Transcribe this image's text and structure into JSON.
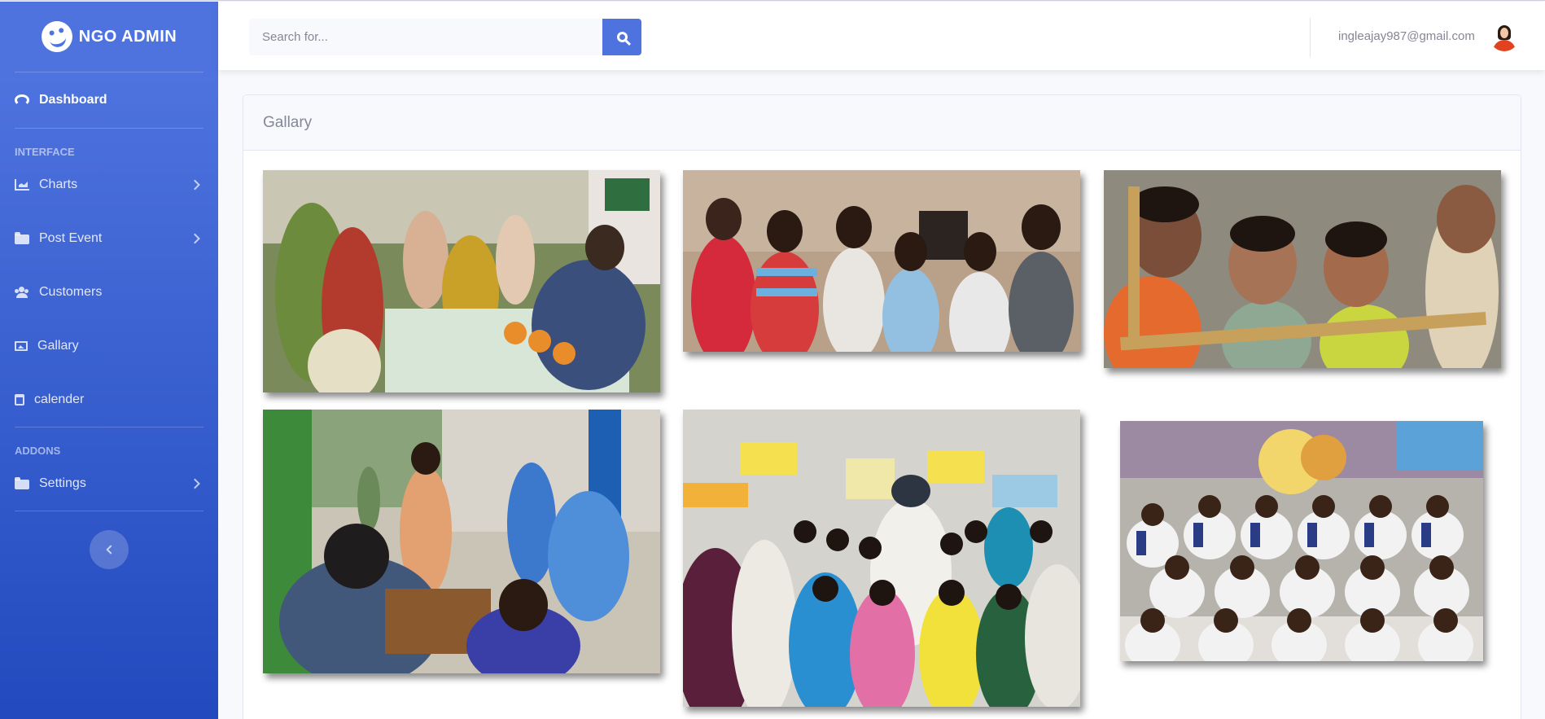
{
  "brand": {
    "name": "NGO ADMIN"
  },
  "sidebar": {
    "dashboard": "Dashboard",
    "heading_interface": "INTERFACE",
    "items": [
      {
        "label": "Charts",
        "icon": "chart-area-icon",
        "has_caret": true
      },
      {
        "label": "Post Event",
        "icon": "folder-icon",
        "has_caret": true
      },
      {
        "label": "Customers",
        "icon": "users-icon",
        "has_caret": false
      },
      {
        "label": "Gallary",
        "icon": "image-icon",
        "has_caret": false
      },
      {
        "label": "calender",
        "icon": "calendar-icon",
        "has_caret": false
      }
    ],
    "heading_addons": "ADDONS",
    "settings": "Settings"
  },
  "topbar": {
    "search_placeholder": "Search for...",
    "user_email": "ingleajay987@gmail.com"
  },
  "gallery": {
    "title": "Gallary"
  },
  "colors": {
    "sidebar_start": "#4e73df",
    "sidebar_end": "#224abe",
    "primary": "#4e73df",
    "text_muted": "#858796"
  }
}
